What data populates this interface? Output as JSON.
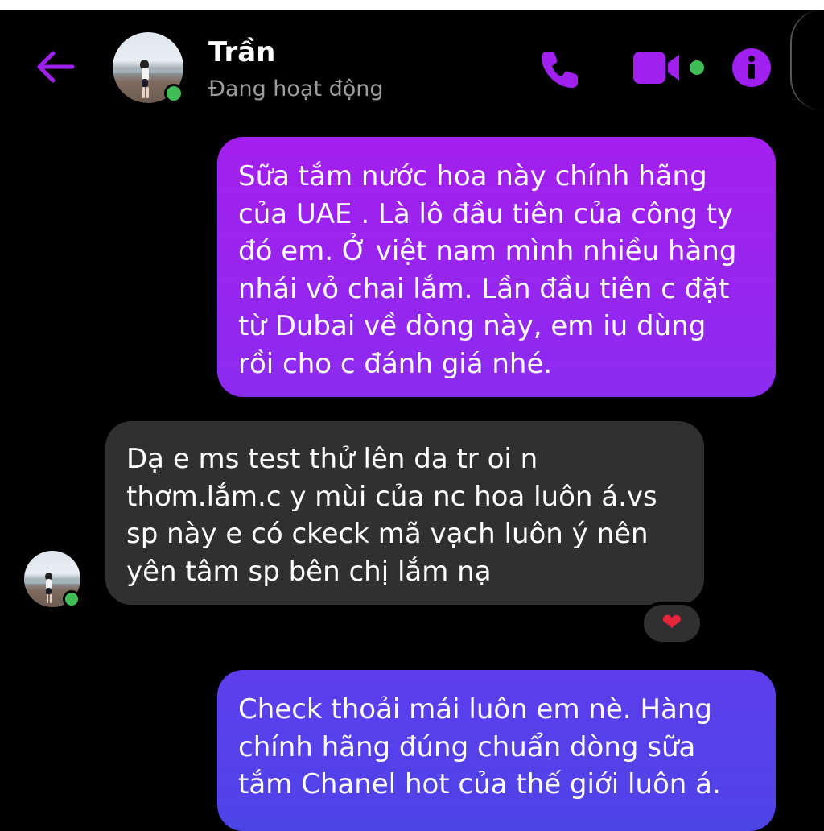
{
  "header": {
    "back_icon": "back-arrow-icon",
    "contact_name": "Trần",
    "status": "Đang hoạt động",
    "call_icon": "phone-icon",
    "video_icon": "video-camera-icon",
    "info_icon": "info-icon"
  },
  "colors": {
    "accent": "#a020f0",
    "outgoing_bubble": "#9a24ee",
    "outgoing_bubble_2": "#5541ea",
    "incoming_bubble": "#303030",
    "online": "#3fbe57"
  },
  "messages": [
    {
      "direction": "outgoing",
      "text": "Sữa tắm nước hoa  này chính hãng\ncủa UAE . Là lô đầu tiên của công ty\nđó em. Ở việt nam mình nhiều hàng\nnhái vỏ chai lắm. Lần đầu tiên c đặt\ntừ Dubai về dòng này, em iu dùng\nrồi cho c đánh giá nhé."
    },
    {
      "direction": "incoming",
      "text": "Dạ e ms test thử lên da tr oi n\nthơm.lắm.c y mùi của nc hoa luôn á.vs\nsp này e có ckeck mã vạch luôn ý nên\nyên tâm sp bên chị lắm nạ",
      "reaction": "❤"
    },
    {
      "direction": "outgoing",
      "text": "Check thoải mái luôn em nè. Hàng\nchính hãng đúng chuẩn dòng sữa\ntắm Chanel hot của thế giới luôn á."
    }
  ]
}
